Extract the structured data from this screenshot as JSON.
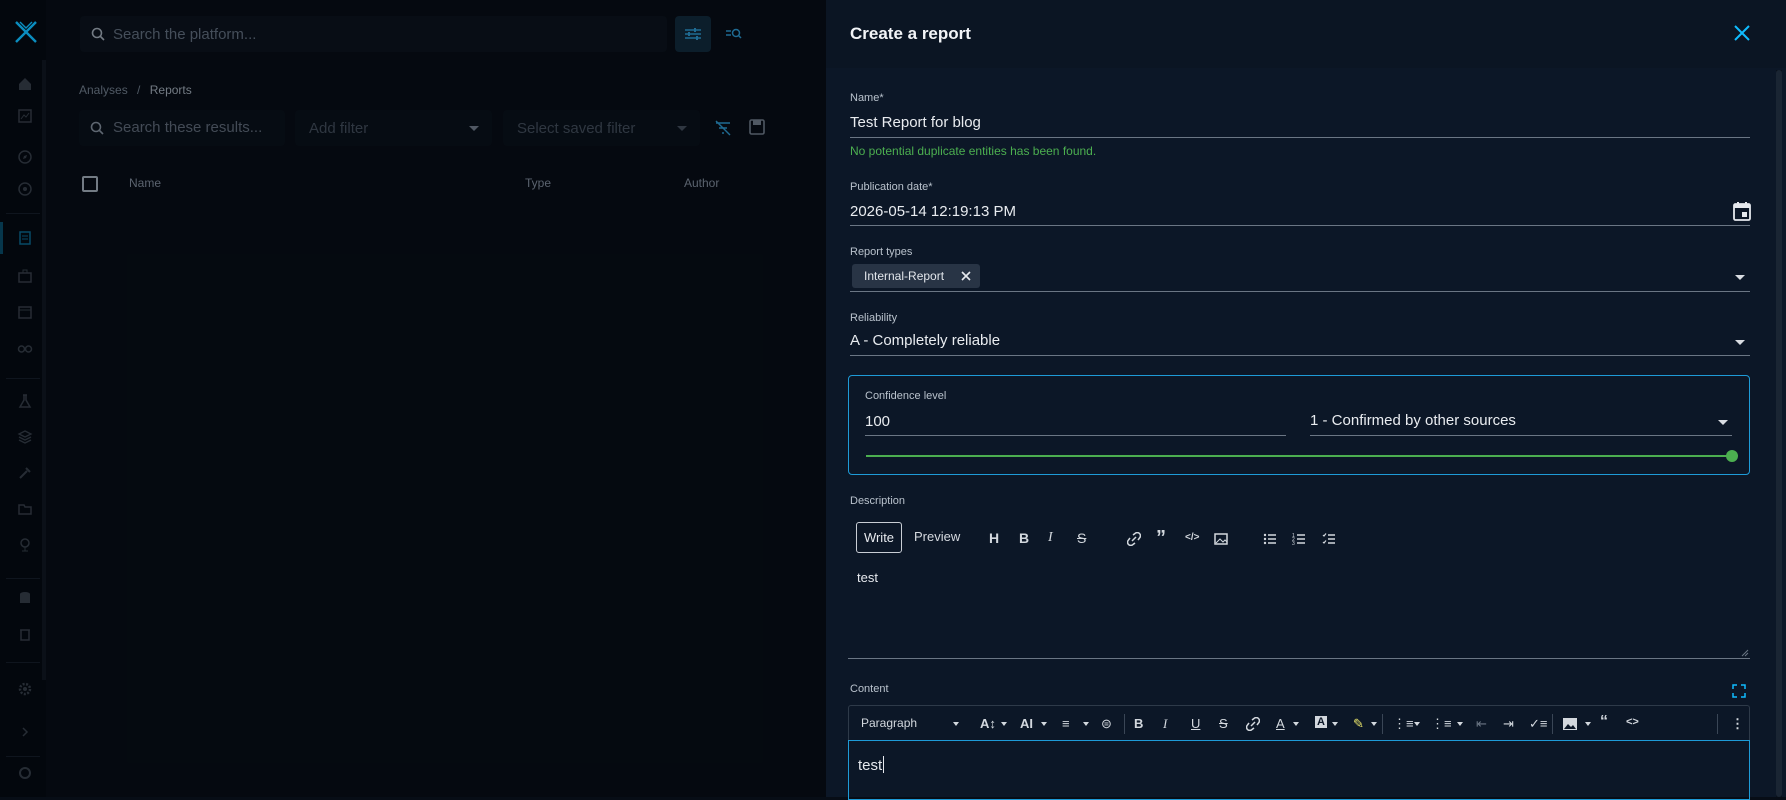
{
  "topbar": {
    "search_placeholder": "Search the platform..."
  },
  "breadcrumb": {
    "parent": "Analyses",
    "separator": "/",
    "current": "Reports"
  },
  "list": {
    "search_placeholder": "Search these results...",
    "add_filter": "Add filter",
    "saved_filter": "Select saved filter",
    "columns": [
      "Name",
      "Type",
      "Author"
    ]
  },
  "panel": {
    "title": "Create a report",
    "name": {
      "label": "Name",
      "required_mark": "*",
      "value": "Test Report for blog",
      "helper": "No potential duplicate entities has been found."
    },
    "publication_date": {
      "label": "Publication date",
      "required_mark": "*",
      "value": "2026-05-14 12:19:13 PM"
    },
    "report_types": {
      "label": "Report types",
      "chips": [
        "Internal-Report"
      ]
    },
    "reliability": {
      "label": "Reliability",
      "value": "A - Completely reliable"
    },
    "confidence": {
      "label": "Confidence level",
      "value": "100",
      "scale_value": "1 - Confirmed by other sources",
      "slider_fraction": 1.0,
      "color": "#4caf50"
    },
    "description": {
      "label": "Description",
      "tab_write": "Write",
      "tab_preview": "Preview",
      "text": "test"
    },
    "content": {
      "label": "Content",
      "paragraph_select": "Paragraph",
      "text": "test"
    }
  },
  "colors": {
    "accent": "#0fbcff",
    "success": "#4caf50",
    "panel_bg": "#0c1727"
  }
}
